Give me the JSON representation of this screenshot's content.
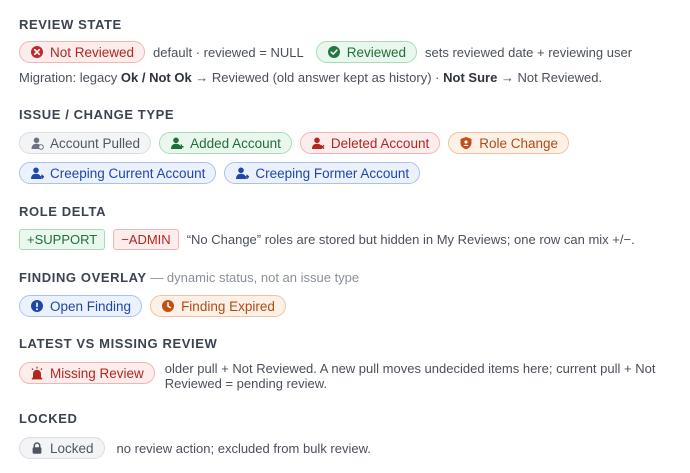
{
  "review_state": {
    "title": "REVIEW STATE",
    "not_reviewed_label": "Not Reviewed",
    "not_reviewed_note": "default · reviewed = NULL",
    "reviewed_label": "Reviewed",
    "reviewed_note": "sets reviewed date + reviewing user",
    "migration_prefix": "Migration: legacy ",
    "migration_ok": "Ok / Not Ok",
    "migration_mid": " → Reviewed (old answer kept as history) · ",
    "migration_notsure": "Not Sure",
    "migration_end": " → Not Reviewed."
  },
  "issue_type": {
    "title": "ISSUE / CHANGE TYPE",
    "account_pulled": "Account Pulled",
    "added_account": "Added Account",
    "deleted_account": "Deleted Account",
    "role_change": "Role Change",
    "creeping_current": "Creeping Current Account",
    "creeping_former": "Creeping Former Account"
  },
  "role_delta": {
    "title": "ROLE DELTA",
    "plus_tag": "+SUPPORT",
    "minus_tag": "−ADMIN",
    "note": "“No Change” roles are stored but hidden in My Reviews; one row can mix +/−."
  },
  "finding_overlay": {
    "title": "FINDING OVERLAY",
    "subtitle": " — dynamic status, not an issue type",
    "open_finding": "Open Finding",
    "finding_expired": "Finding Expired"
  },
  "latest_missing": {
    "title": "LATEST VS MISSING REVIEW",
    "missing_review": "Missing Review",
    "note_line1": "older pull + Not Reviewed. A new pull moves undecided items here; current pull + Not",
    "note_line2": "Reviewed = pending review."
  },
  "locked": {
    "title": "LOCKED",
    "locked_label": "Locked",
    "note": "no review action; excluded from bulk review."
  },
  "colors": {
    "red": "#b3261e",
    "green": "#1f6f3a",
    "gray": "#4f5661",
    "orange": "#b14a12",
    "blue": "#1f47a8"
  }
}
